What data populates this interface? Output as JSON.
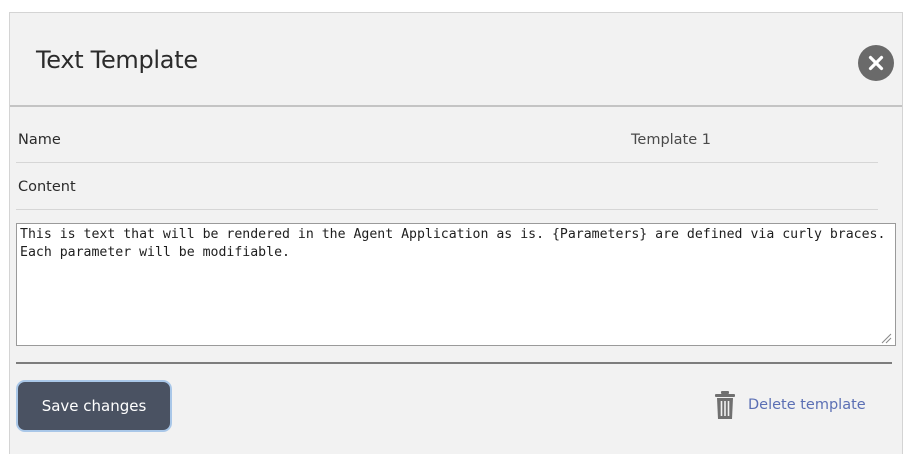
{
  "dialog": {
    "title": "Text Template",
    "close_icon": "close-circle-icon"
  },
  "fields": {
    "name_label": "Name",
    "name_value": "Template 1",
    "content_label": "Content",
    "content_value": "This is text that will be rendered in the Agent Application as is. {Parameters} are defined via curly braces. Each parameter will be modifiable."
  },
  "footer": {
    "save_label": "Save changes",
    "delete_label": "Delete template",
    "delete_icon": "trash-icon"
  },
  "colors": {
    "dialog_background": "#f2f2f2",
    "save_button": "#4a5262",
    "save_button_focus_ring": "#a9c7e8",
    "link": "#5b6fb4",
    "close_button": "#6a6a6a"
  }
}
